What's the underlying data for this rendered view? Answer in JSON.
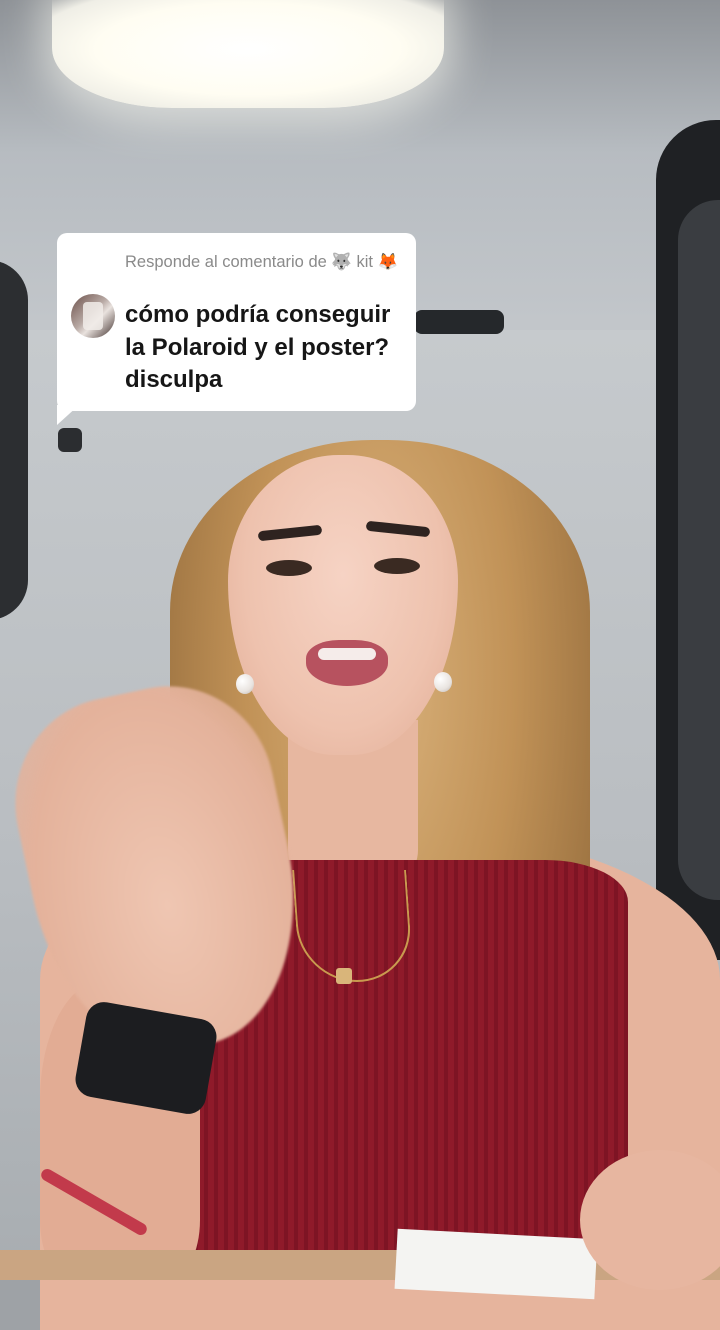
{
  "reply": {
    "header": "Responde al comentario de 🐺 kit 🦊",
    "comment": "cómo podría conseguir la Polaroid y el poster? disculpa"
  },
  "icons": {
    "avatar": "user-avatar-photo"
  },
  "colors": {
    "bubble_background": "#ffffff",
    "header_text": "#8a8a8a",
    "comment_text": "#161616"
  }
}
